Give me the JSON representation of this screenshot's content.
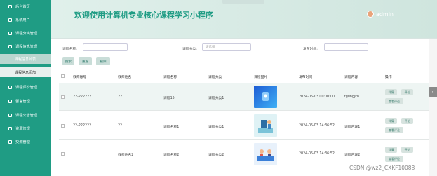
{
  "sidebar": {
    "home": "后台首页",
    "items": [
      {
        "label": "系统用户"
      },
      {
        "label": "课程分类管理"
      },
      {
        "label": "课程信息管理"
      },
      {
        "label": "课程信息列表"
      },
      {
        "label": "课程信息添加"
      },
      {
        "label": "课程评价管理"
      },
      {
        "label": "留言管理"
      },
      {
        "label": "课程公告管理"
      },
      {
        "label": "资源管理"
      },
      {
        "label": "交流管理"
      }
    ]
  },
  "header": {
    "title": "欢迎使用计算机专业核心课程学习小程序",
    "user": "admin"
  },
  "filters": {
    "name_label": "课程名称:",
    "category_label": "课程分类:",
    "category_value": "请选择",
    "time_label": "发布时间:"
  },
  "buttons": {
    "search": "搜索",
    "reset": "重置",
    "delete": "删除"
  },
  "table": {
    "headers": [
      "教师账号",
      "教师姓名",
      "课程名称",
      "课程分类",
      "课程图片",
      "发布时间",
      "课程内容",
      "操作"
    ],
    "rows": [
      {
        "account": "22-222222",
        "teacher": "22",
        "course": "课程15",
        "category": "课程分类1",
        "time": "2024-05-03 00:00:00",
        "content": "fgdhgjkh",
        "image": "blue-icon"
      },
      {
        "account": "22-222222",
        "teacher": "22",
        "course": "课程名称1",
        "category": "课程分类1",
        "time": "2024-05-03 14:36:52",
        "content": "课程内容1",
        "image": "study-illustration"
      },
      {
        "account": "",
        "teacher": "教师姓名2",
        "course": "课程名称2",
        "category": "课程分类2",
        "time": "2024-05-03 14:36:52",
        "content": "课程内容2",
        "image": "meeting-illustration"
      }
    ],
    "actions": {
      "edit": "详情",
      "delete": "评论",
      "review": "查看评论"
    }
  },
  "watermark": "CSDN @wz2_CXKF10088",
  "colors": {
    "sidebar": "#1f9c84",
    "accent": "#1f9c84"
  }
}
